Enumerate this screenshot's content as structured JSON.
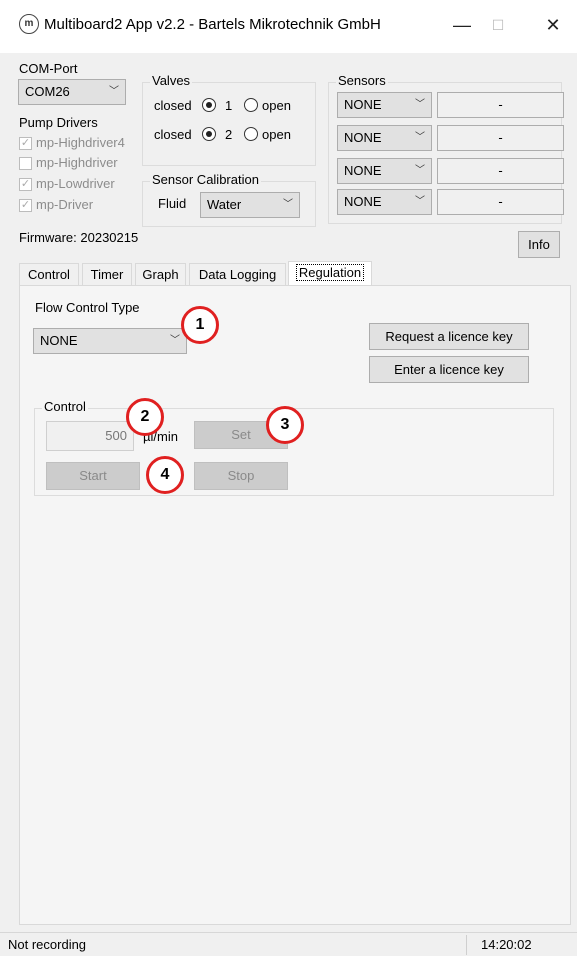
{
  "window": {
    "title": "Multiboard2 App v2.2 - Bartels Mikrotechnik GmbH",
    "icon_letter": "m",
    "minimize": "—",
    "maximize": "☐",
    "close": "✕"
  },
  "com_port": {
    "label": "COM-Port",
    "value": "COM26"
  },
  "pump_drivers": {
    "label": "Pump Drivers",
    "items": [
      {
        "label": "mp-Highdriver4",
        "checked": true
      },
      {
        "label": "mp-Highdriver",
        "checked": false
      },
      {
        "label": "mp-Lowdriver",
        "checked": true
      },
      {
        "label": "mp-Driver",
        "checked": true
      }
    ]
  },
  "valves": {
    "label": "Valves",
    "rows": [
      {
        "closed_label": "closed",
        "number": "1",
        "open_label": "open",
        "state": "closed"
      },
      {
        "closed_label": "closed",
        "number": "2",
        "open_label": "open",
        "state": "closed"
      }
    ]
  },
  "sensor_calibration": {
    "label": "Sensor Calibration",
    "fluid_label": "Fluid",
    "fluid_value": "Water"
  },
  "sensors": {
    "label": "Sensors",
    "rows": [
      {
        "type": "NONE",
        "value": "-"
      },
      {
        "type": "NONE",
        "value": "-"
      },
      {
        "type": "NONE",
        "value": "-"
      },
      {
        "type": "NONE",
        "value": "-"
      }
    ]
  },
  "firmware": "Firmware: 20230215",
  "info_button": "Info",
  "tabs": [
    "Control",
    "Timer",
    "Graph",
    "Data Logging",
    "Regulation"
  ],
  "active_tab": "Regulation",
  "regulation": {
    "flow_control_label": "Flow Control Type",
    "flow_control_value": "NONE",
    "request_licence": "Request a licence key",
    "enter_licence": "Enter a licence key",
    "control_label": "Control",
    "flow_value": "500",
    "flow_unit": "µl/min",
    "set_button": "Set",
    "start_button": "Start",
    "stop_button": "Stop"
  },
  "markers": [
    "1",
    "2",
    "3",
    "4"
  ],
  "status": {
    "recording": "Not recording",
    "time": "14:20:02"
  },
  "colors": {
    "marker_ring": "#e02020"
  }
}
